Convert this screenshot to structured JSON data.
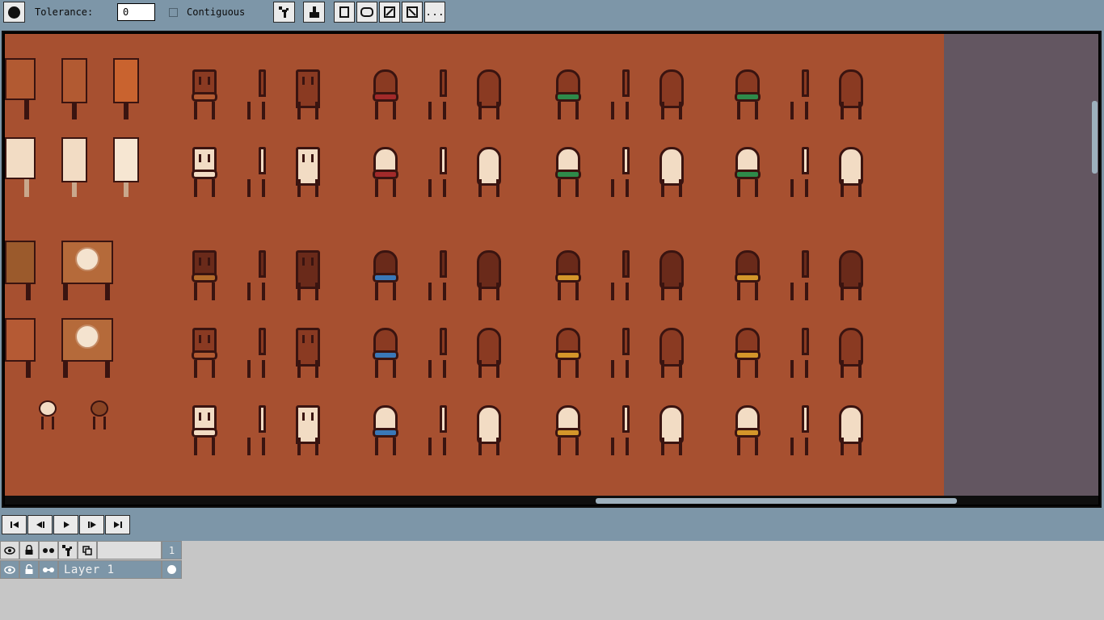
{
  "toolbar": {
    "tool_icon": "paint-bucket-circle-icon",
    "tolerance_label": "Tolerance:",
    "tolerance_value": "0",
    "contiguous_label": "Contiguous",
    "contiguous_checked": false,
    "buttons": [
      {
        "name": "pixel-perfect-icon",
        "glyph": "▚"
      },
      {
        "name": "fill-bucket-icon",
        "glyph": "⛁"
      },
      {
        "name": "brush-square-icon",
        "glyph": "▣"
      },
      {
        "name": "brush-round-icon",
        "glyph": "◙"
      },
      {
        "name": "brush-diagonal-icon",
        "glyph": "⧄"
      },
      {
        "name": "brush-diagonal-alt-icon",
        "glyph": "⧅"
      }
    ],
    "more_label": "..."
  },
  "canvas": {
    "background_color": "#a75030",
    "out_of_bounds_color": "#635661"
  },
  "playback": [
    {
      "name": "first-frame-button",
      "glyph": "⏮"
    },
    {
      "name": "previous-frame-button",
      "glyph": "◁▏"
    },
    {
      "name": "play-button",
      "glyph": "▶"
    },
    {
      "name": "next-frame-button",
      "glyph": "▕▷"
    },
    {
      "name": "last-frame-button",
      "glyph": "⏭"
    }
  ],
  "timeline": {
    "header_icons": [
      "eye-icon",
      "lock-icon",
      "onion-skin-icon",
      "link-cels-icon",
      "layers-icon"
    ],
    "frame_number": "1",
    "layers": [
      {
        "name": "Layer 1",
        "visible": true,
        "locked": false
      }
    ]
  }
}
